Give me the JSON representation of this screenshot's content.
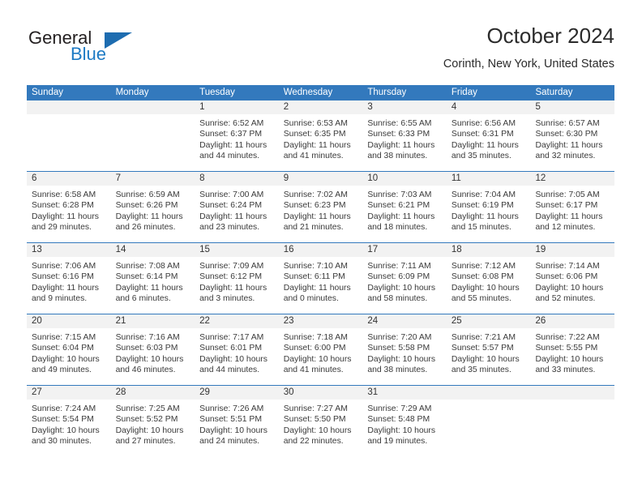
{
  "brand": {
    "name_part1": "General",
    "name_part2": "Blue",
    "accent_color": "#1d7ac4",
    "triangle_color": "#1d6cb0"
  },
  "header": {
    "title": "October 2024",
    "location": "Corinth, New York, United States"
  },
  "theme": {
    "header_blue": "#3379bd",
    "daynum_band": "#f2f2f2",
    "text": "#3a3a3a"
  },
  "weekdays": [
    "Sunday",
    "Monday",
    "Tuesday",
    "Wednesday",
    "Thursday",
    "Friday",
    "Saturday"
  ],
  "weeks": [
    [
      {
        "day": "",
        "sunrise": "",
        "sunset": "",
        "daylight1": "",
        "daylight2": "",
        "empty": true
      },
      {
        "day": "",
        "sunrise": "",
        "sunset": "",
        "daylight1": "",
        "daylight2": "",
        "empty": true
      },
      {
        "day": "1",
        "sunrise": "Sunrise: 6:52 AM",
        "sunset": "Sunset: 6:37 PM",
        "daylight1": "Daylight: 11 hours",
        "daylight2": "and 44 minutes."
      },
      {
        "day": "2",
        "sunrise": "Sunrise: 6:53 AM",
        "sunset": "Sunset: 6:35 PM",
        "daylight1": "Daylight: 11 hours",
        "daylight2": "and 41 minutes."
      },
      {
        "day": "3",
        "sunrise": "Sunrise: 6:55 AM",
        "sunset": "Sunset: 6:33 PM",
        "daylight1": "Daylight: 11 hours",
        "daylight2": "and 38 minutes."
      },
      {
        "day": "4",
        "sunrise": "Sunrise: 6:56 AM",
        "sunset": "Sunset: 6:31 PM",
        "daylight1": "Daylight: 11 hours",
        "daylight2": "and 35 minutes."
      },
      {
        "day": "5",
        "sunrise": "Sunrise: 6:57 AM",
        "sunset": "Sunset: 6:30 PM",
        "daylight1": "Daylight: 11 hours",
        "daylight2": "and 32 minutes."
      }
    ],
    [
      {
        "day": "6",
        "sunrise": "Sunrise: 6:58 AM",
        "sunset": "Sunset: 6:28 PM",
        "daylight1": "Daylight: 11 hours",
        "daylight2": "and 29 minutes."
      },
      {
        "day": "7",
        "sunrise": "Sunrise: 6:59 AM",
        "sunset": "Sunset: 6:26 PM",
        "daylight1": "Daylight: 11 hours",
        "daylight2": "and 26 minutes."
      },
      {
        "day": "8",
        "sunrise": "Sunrise: 7:00 AM",
        "sunset": "Sunset: 6:24 PM",
        "daylight1": "Daylight: 11 hours",
        "daylight2": "and 23 minutes."
      },
      {
        "day": "9",
        "sunrise": "Sunrise: 7:02 AM",
        "sunset": "Sunset: 6:23 PM",
        "daylight1": "Daylight: 11 hours",
        "daylight2": "and 21 minutes."
      },
      {
        "day": "10",
        "sunrise": "Sunrise: 7:03 AM",
        "sunset": "Sunset: 6:21 PM",
        "daylight1": "Daylight: 11 hours",
        "daylight2": "and 18 minutes."
      },
      {
        "day": "11",
        "sunrise": "Sunrise: 7:04 AM",
        "sunset": "Sunset: 6:19 PM",
        "daylight1": "Daylight: 11 hours",
        "daylight2": "and 15 minutes."
      },
      {
        "day": "12",
        "sunrise": "Sunrise: 7:05 AM",
        "sunset": "Sunset: 6:17 PM",
        "daylight1": "Daylight: 11 hours",
        "daylight2": "and 12 minutes."
      }
    ],
    [
      {
        "day": "13",
        "sunrise": "Sunrise: 7:06 AM",
        "sunset": "Sunset: 6:16 PM",
        "daylight1": "Daylight: 11 hours",
        "daylight2": "and 9 minutes."
      },
      {
        "day": "14",
        "sunrise": "Sunrise: 7:08 AM",
        "sunset": "Sunset: 6:14 PM",
        "daylight1": "Daylight: 11 hours",
        "daylight2": "and 6 minutes."
      },
      {
        "day": "15",
        "sunrise": "Sunrise: 7:09 AM",
        "sunset": "Sunset: 6:12 PM",
        "daylight1": "Daylight: 11 hours",
        "daylight2": "and 3 minutes."
      },
      {
        "day": "16",
        "sunrise": "Sunrise: 7:10 AM",
        "sunset": "Sunset: 6:11 PM",
        "daylight1": "Daylight: 11 hours",
        "daylight2": "and 0 minutes."
      },
      {
        "day": "17",
        "sunrise": "Sunrise: 7:11 AM",
        "sunset": "Sunset: 6:09 PM",
        "daylight1": "Daylight: 10 hours",
        "daylight2": "and 58 minutes."
      },
      {
        "day": "18",
        "sunrise": "Sunrise: 7:12 AM",
        "sunset": "Sunset: 6:08 PM",
        "daylight1": "Daylight: 10 hours",
        "daylight2": "and 55 minutes."
      },
      {
        "day": "19",
        "sunrise": "Sunrise: 7:14 AM",
        "sunset": "Sunset: 6:06 PM",
        "daylight1": "Daylight: 10 hours",
        "daylight2": "and 52 minutes."
      }
    ],
    [
      {
        "day": "20",
        "sunrise": "Sunrise: 7:15 AM",
        "sunset": "Sunset: 6:04 PM",
        "daylight1": "Daylight: 10 hours",
        "daylight2": "and 49 minutes."
      },
      {
        "day": "21",
        "sunrise": "Sunrise: 7:16 AM",
        "sunset": "Sunset: 6:03 PM",
        "daylight1": "Daylight: 10 hours",
        "daylight2": "and 46 minutes."
      },
      {
        "day": "22",
        "sunrise": "Sunrise: 7:17 AM",
        "sunset": "Sunset: 6:01 PM",
        "daylight1": "Daylight: 10 hours",
        "daylight2": "and 44 minutes."
      },
      {
        "day": "23",
        "sunrise": "Sunrise: 7:18 AM",
        "sunset": "Sunset: 6:00 PM",
        "daylight1": "Daylight: 10 hours",
        "daylight2": "and 41 minutes."
      },
      {
        "day": "24",
        "sunrise": "Sunrise: 7:20 AM",
        "sunset": "Sunset: 5:58 PM",
        "daylight1": "Daylight: 10 hours",
        "daylight2": "and 38 minutes."
      },
      {
        "day": "25",
        "sunrise": "Sunrise: 7:21 AM",
        "sunset": "Sunset: 5:57 PM",
        "daylight1": "Daylight: 10 hours",
        "daylight2": "and 35 minutes."
      },
      {
        "day": "26",
        "sunrise": "Sunrise: 7:22 AM",
        "sunset": "Sunset: 5:55 PM",
        "daylight1": "Daylight: 10 hours",
        "daylight2": "and 33 minutes."
      }
    ],
    [
      {
        "day": "27",
        "sunrise": "Sunrise: 7:24 AM",
        "sunset": "Sunset: 5:54 PM",
        "daylight1": "Daylight: 10 hours",
        "daylight2": "and 30 minutes."
      },
      {
        "day": "28",
        "sunrise": "Sunrise: 7:25 AM",
        "sunset": "Sunset: 5:52 PM",
        "daylight1": "Daylight: 10 hours",
        "daylight2": "and 27 minutes."
      },
      {
        "day": "29",
        "sunrise": "Sunrise: 7:26 AM",
        "sunset": "Sunset: 5:51 PM",
        "daylight1": "Daylight: 10 hours",
        "daylight2": "and 24 minutes."
      },
      {
        "day": "30",
        "sunrise": "Sunrise: 7:27 AM",
        "sunset": "Sunset: 5:50 PM",
        "daylight1": "Daylight: 10 hours",
        "daylight2": "and 22 minutes."
      },
      {
        "day": "31",
        "sunrise": "Sunrise: 7:29 AM",
        "sunset": "Sunset: 5:48 PM",
        "daylight1": "Daylight: 10 hours",
        "daylight2": "and 19 minutes."
      },
      {
        "day": "",
        "sunrise": "",
        "sunset": "",
        "daylight1": "",
        "daylight2": "",
        "empty": true
      },
      {
        "day": "",
        "sunrise": "",
        "sunset": "",
        "daylight1": "",
        "daylight2": "",
        "empty": true
      }
    ]
  ]
}
